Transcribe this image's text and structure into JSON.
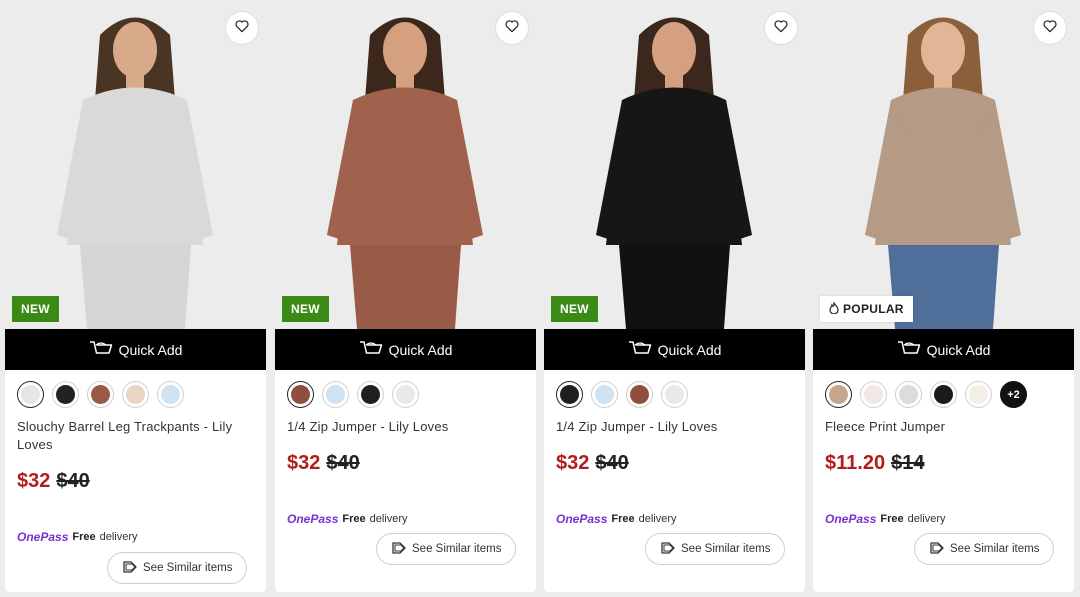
{
  "colors": {
    "accent_price": "#b31c1c",
    "new_badge": "#3b8a16",
    "onepass": "#7b2fcf",
    "quick_add_bg": "#000000"
  },
  "products": [
    {
      "badge": "NEW",
      "badge_type": "new",
      "quick_add_label": "Quick Add",
      "title": "Slouchy Barrel Leg Trackpants - Lily Loves",
      "price_now": "$32",
      "price_was": "$40",
      "onepass_label": "OnePass",
      "free_label": "Free",
      "delivery_label": "delivery",
      "similar_label": "See Similar items",
      "swatch_colors": [
        "#e6e6e6",
        "#222222",
        "#9a5a48",
        "#e8d5c4",
        "#cfe3f2"
      ],
      "more_label": "",
      "model": {
        "top": "#d9d9d9",
        "bottom": "#d5d5d5",
        "hair": "#4a3424",
        "skin": "#d9aa8a",
        "bg": "#ececec"
      }
    },
    {
      "badge": "NEW",
      "badge_type": "new",
      "quick_add_label": "Quick Add",
      "title": "1/4 Zip Jumper - Lily Loves",
      "price_now": "$32",
      "price_was": "$40",
      "onepass_label": "OnePass",
      "free_label": "Free",
      "delivery_label": "delivery",
      "similar_label": "See Similar items",
      "swatch_colors": [
        "#8e4f3e",
        "#cde2f3",
        "#1e1e1e",
        "#e9e9e9"
      ],
      "more_label": "",
      "model": {
        "top": "#a0614d",
        "bottom": "#995a47",
        "hair": "#3b271c",
        "skin": "#d4a07f",
        "bg": "#ececec"
      }
    },
    {
      "badge": "NEW",
      "badge_type": "new",
      "quick_add_label": "Quick Add",
      "title": "1/4 Zip Jumper - Lily Loves",
      "price_now": "$32",
      "price_was": "$40",
      "onepass_label": "OnePass",
      "free_label": "Free",
      "delivery_label": "delivery",
      "similar_label": "See Similar items",
      "swatch_colors": [
        "#1e1e1e",
        "#cde2f3",
        "#8e4f3e",
        "#e9e9e9"
      ],
      "more_label": "",
      "model": {
        "top": "#161616",
        "bottom": "#111111",
        "hair": "#3b271c",
        "skin": "#d4a07f",
        "bg": "#ececec"
      }
    },
    {
      "badge": "POPULAR",
      "badge_type": "popular",
      "quick_add_label": "Quick Add",
      "title": "Fleece Print Jumper",
      "price_now": "$11.20",
      "price_was": "$14",
      "onepass_label": "OnePass",
      "free_label": "Free",
      "delivery_label": "delivery",
      "similar_label": "See Similar items",
      "swatch_colors": [
        "#c4a68e",
        "#f2e6e6",
        "#dcdcdc",
        "#1a1a1a",
        "#f4f0e8"
      ],
      "more_label": "+2",
      "model": {
        "top": "#b59a85",
        "bottom": "#4f6f9a",
        "hair": "#8a5f3a",
        "skin": "#e2b597",
        "bg": "#ececec"
      }
    }
  ]
}
